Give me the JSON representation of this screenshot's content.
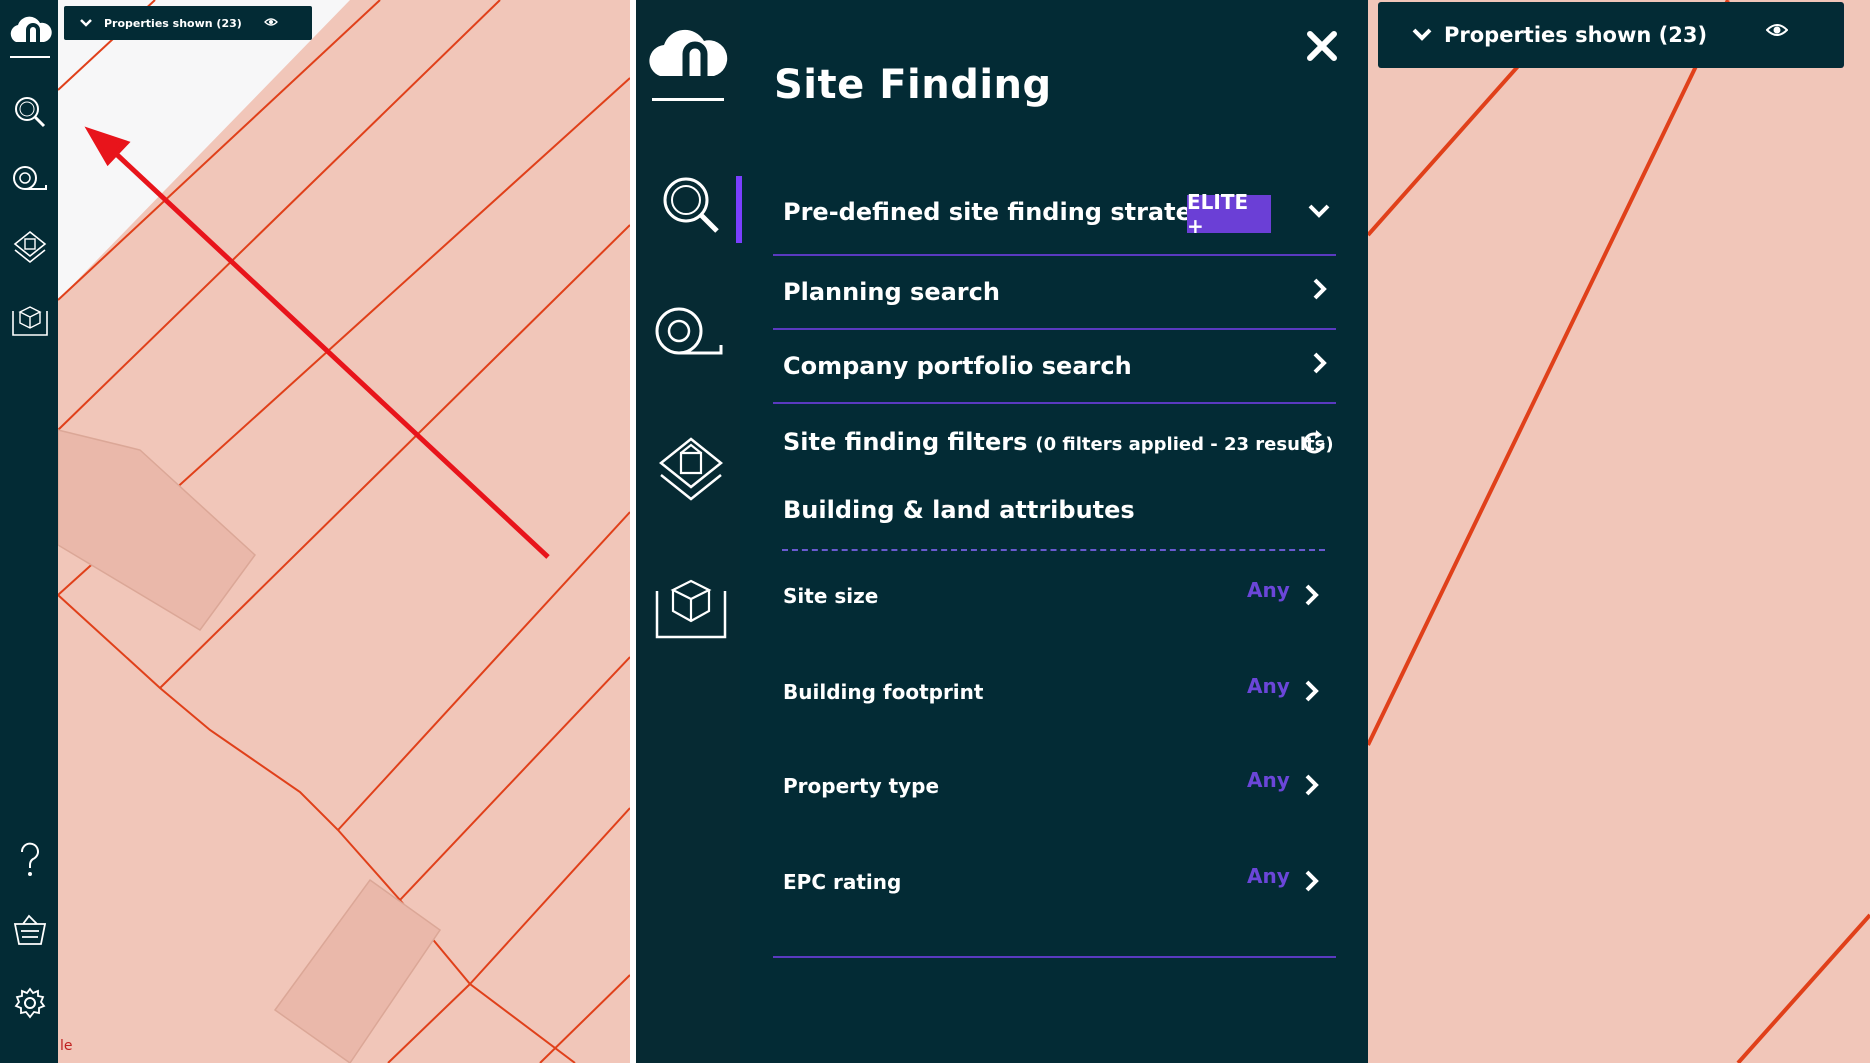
{
  "properties_shown": {
    "label": "Properties shown (23)"
  },
  "panel": {
    "title": "Site Finding",
    "sections": {
      "strategies": {
        "label": "Pre-defined site finding strategies",
        "badge": "ELITE +"
      },
      "planning": {
        "label": "Planning search"
      },
      "portfolio": {
        "label": "Company portfolio search"
      },
      "filters": {
        "label": "Site finding filters",
        "note": "(0 filters applied - 23 results)"
      },
      "attributes": {
        "label": "Building & land attributes"
      }
    },
    "filters": [
      {
        "label": "Site size",
        "value": "Any"
      },
      {
        "label": "Building footprint",
        "value": "Any"
      },
      {
        "label": "Property type",
        "value": "Any"
      },
      {
        "label": "EPC rating",
        "value": "Any"
      }
    ]
  },
  "map_fragment_text": "le",
  "icons": {
    "logo": "cloud-n-logo-icon",
    "search": "magnifier-icon",
    "measure": "tape-measure-icon",
    "layers": "building-layers-icon",
    "map3d": "map-box-icon",
    "help": "question-icon",
    "basket": "basket-icon",
    "settings": "gear-icon",
    "close": "close-icon",
    "eye": "eye-icon",
    "refresh": "refresh-icon"
  },
  "colors": {
    "navy": "#032b35",
    "parcel": "#f1c6b9",
    "parcel_line": "#e0401a",
    "accent": "#6b3fd6",
    "arrow": "#e8141b"
  }
}
